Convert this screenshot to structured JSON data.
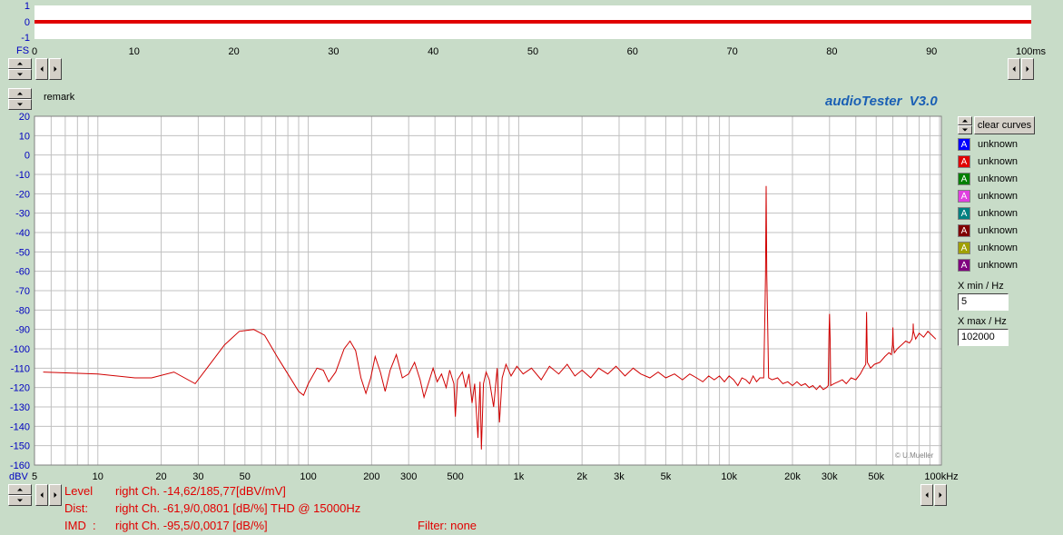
{
  "time_panel": {
    "y_ticks": [
      "1",
      "0",
      "-1"
    ],
    "y_unit": "FS",
    "x_ticks": [
      "0",
      "10",
      "20",
      "30",
      "40",
      "50",
      "60",
      "70",
      "80",
      "90"
    ],
    "x_unit_label": "100ms",
    "signal_color": "#e00000"
  },
  "remark_label": "remark",
  "app_title": "audioTester  V3.0",
  "copyright": "© U.Mueller",
  "clear_curves_label": "clear curves",
  "legend": [
    {
      "label": "unknown",
      "color": "#0000ff"
    },
    {
      "label": "unknown",
      "color": "#e00000"
    },
    {
      "label": "unknown",
      "color": "#008000"
    },
    {
      "label": "unknown",
      "color": "#e040e0"
    },
    {
      "label": "unknown",
      "color": "#008080"
    },
    {
      "label": "unknown",
      "color": "#800000"
    },
    {
      "label": "unknown",
      "color": "#a0a000"
    },
    {
      "label": "unknown",
      "color": "#800080"
    }
  ],
  "legend_glyph": "A",
  "xmin": {
    "label": "X min / Hz",
    "value": "5"
  },
  "xmax": {
    "label": "X max / Hz",
    "value": "102000"
  },
  "status": {
    "level_key": "Level",
    "level_val": "right Ch. -14,62/185,77[dBV/mV]",
    "dist_key": "Dist:",
    "dist_val": "right Ch. -61,9/0,0801 [dB/%] THD @ 15000Hz",
    "imd_key": "IMD  :",
    "imd_val": "right Ch. -95,5/0,0017 [dB/%]",
    "filter": "Filter: none"
  },
  "chart_data": {
    "type": "line",
    "xscale": "log",
    "ylabel": "dBV",
    "xlim": [
      5,
      102000
    ],
    "ylim": [
      -160,
      20
    ],
    "y_ticks": [
      "20",
      "10",
      "0",
      "-10",
      "-20",
      "-30",
      "-40",
      "-50",
      "-60",
      "-70",
      "-80",
      "-90",
      "-100",
      "-110",
      "-120",
      "-130",
      "-140",
      "-150",
      "-160"
    ],
    "x_tick_labels": [
      {
        "v": 5,
        "t": "5"
      },
      {
        "v": 10,
        "t": "10"
      },
      {
        "v": 20,
        "t": "20"
      },
      {
        "v": 30,
        "t": "30"
      },
      {
        "v": 50,
        "t": "50"
      },
      {
        "v": 100,
        "t": "100"
      },
      {
        "v": 200,
        "t": "200"
      },
      {
        "v": 300,
        "t": "300"
      },
      {
        "v": 500,
        "t": "500"
      },
      {
        "v": 1000,
        "t": "1k"
      },
      {
        "v": 2000,
        "t": "2k"
      },
      {
        "v": 3000,
        "t": "3k"
      },
      {
        "v": 5000,
        "t": "5k"
      },
      {
        "v": 10000,
        "t": "10k"
      },
      {
        "v": 20000,
        "t": "20k"
      },
      {
        "v": 30000,
        "t": "30k"
      },
      {
        "v": 50000,
        "t": "50k"
      },
      {
        "v": 102000,
        "t": "100kHz"
      }
    ],
    "grid": true,
    "series": [
      {
        "color": "#d00000",
        "points": [
          [
            5.5,
            -112
          ],
          [
            10,
            -113
          ],
          [
            15,
            -115
          ],
          [
            18,
            -115
          ],
          [
            23,
            -112
          ],
          [
            29,
            -118
          ],
          [
            33,
            -110
          ],
          [
            40,
            -98
          ],
          [
            47,
            -91
          ],
          [
            55,
            -90
          ],
          [
            62,
            -93
          ],
          [
            72,
            -105
          ],
          [
            80,
            -113
          ],
          [
            90,
            -122
          ],
          [
            95,
            -124
          ],
          [
            100,
            -118
          ],
          [
            110,
            -110
          ],
          [
            118,
            -111
          ],
          [
            125,
            -117
          ],
          [
            135,
            -112
          ],
          [
            148,
            -100
          ],
          [
            158,
            -96
          ],
          [
            168,
            -101
          ],
          [
            178,
            -115
          ],
          [
            188,
            -123
          ],
          [
            198,
            -115
          ],
          [
            208,
            -104
          ],
          [
            220,
            -112
          ],
          [
            232,
            -122
          ],
          [
            245,
            -111
          ],
          [
            262,
            -103
          ],
          [
            280,
            -115
          ],
          [
            300,
            -113
          ],
          [
            320,
            -107
          ],
          [
            340,
            -116
          ],
          [
            355,
            -125
          ],
          [
            372,
            -118
          ],
          [
            392,
            -110
          ],
          [
            410,
            -117
          ],
          [
            430,
            -113
          ],
          [
            452,
            -120
          ],
          [
            470,
            -111
          ],
          [
            492,
            -118
          ],
          [
            500,
            -135
          ],
          [
            512,
            -116
          ],
          [
            540,
            -112
          ],
          [
            560,
            -120
          ],
          [
            580,
            -113
          ],
          [
            600,
            -128
          ],
          [
            618,
            -118
          ],
          [
            640,
            -146
          ],
          [
            655,
            -117
          ],
          [
            665,
            -152
          ],
          [
            680,
            -118
          ],
          [
            700,
            -112
          ],
          [
            725,
            -116
          ],
          [
            760,
            -130
          ],
          [
            790,
            -110
          ],
          [
            810,
            -138
          ],
          [
            835,
            -115
          ],
          [
            870,
            -108
          ],
          [
            920,
            -114
          ],
          [
            980,
            -109
          ],
          [
            1050,
            -113
          ],
          [
            1150,
            -110
          ],
          [
            1280,
            -116
          ],
          [
            1400,
            -109
          ],
          [
            1550,
            -113
          ],
          [
            1700,
            -108
          ],
          [
            1850,
            -114
          ],
          [
            2000,
            -111
          ],
          [
            2200,
            -115
          ],
          [
            2400,
            -110
          ],
          [
            2650,
            -113
          ],
          [
            2900,
            -109
          ],
          [
            3200,
            -114
          ],
          [
            3500,
            -110
          ],
          [
            3800,
            -113
          ],
          [
            4200,
            -115
          ],
          [
            4600,
            -112
          ],
          [
            5000,
            -115
          ],
          [
            5500,
            -113
          ],
          [
            6000,
            -116
          ],
          [
            6500,
            -113
          ],
          [
            7000,
            -115
          ],
          [
            7500,
            -117
          ],
          [
            8000,
            -114
          ],
          [
            8500,
            -116
          ],
          [
            9000,
            -114
          ],
          [
            9500,
            -117
          ],
          [
            10000,
            -114
          ],
          [
            10500,
            -116
          ],
          [
            11000,
            -119
          ],
          [
            11500,
            -115
          ],
          [
            12000,
            -116
          ],
          [
            12500,
            -118
          ],
          [
            13000,
            -114
          ],
          [
            13500,
            -117
          ],
          [
            14000,
            -115
          ],
          [
            14600,
            -115
          ],
          [
            14800,
            -80
          ],
          [
            14900,
            -62
          ],
          [
            15000,
            -16
          ],
          [
            15100,
            -62
          ],
          [
            15200,
            -80
          ],
          [
            15400,
            -115
          ],
          [
            16000,
            -116
          ],
          [
            17000,
            -115
          ],
          [
            18000,
            -118
          ],
          [
            19000,
            -117
          ],
          [
            20000,
            -119
          ],
          [
            21000,
            -117
          ],
          [
            22000,
            -119
          ],
          [
            23000,
            -118
          ],
          [
            24000,
            -120
          ],
          [
            25000,
            -119
          ],
          [
            26000,
            -121
          ],
          [
            27000,
            -119
          ],
          [
            28000,
            -121
          ],
          [
            29000,
            -120
          ],
          [
            29600,
            -119
          ],
          [
            29800,
            -95
          ],
          [
            30000,
            -82
          ],
          [
            30200,
            -95
          ],
          [
            30400,
            -119
          ],
          [
            31500,
            -118
          ],
          [
            33000,
            -117
          ],
          [
            34500,
            -116
          ],
          [
            36000,
            -118
          ],
          [
            38000,
            -115
          ],
          [
            40000,
            -116
          ],
          [
            42000,
            -113
          ],
          [
            43500,
            -110
          ],
          [
            44600,
            -108
          ],
          [
            44800,
            -95
          ],
          [
            45000,
            -81
          ],
          [
            45200,
            -95
          ],
          [
            45400,
            -107
          ],
          [
            47000,
            -110
          ],
          [
            49000,
            -108
          ],
          [
            52000,
            -107
          ],
          [
            55000,
            -104
          ],
          [
            57500,
            -102
          ],
          [
            59000,
            -103
          ],
          [
            59700,
            -98
          ],
          [
            60000,
            -89
          ],
          [
            60300,
            -98
          ],
          [
            61000,
            -102
          ],
          [
            63000,
            -100
          ],
          [
            66000,
            -98
          ],
          [
            69000,
            -96
          ],
          [
            72000,
            -97
          ],
          [
            74000,
            -95
          ],
          [
            74800,
            -91
          ],
          [
            75000,
            -87
          ],
          [
            75200,
            -91
          ],
          [
            77000,
            -95
          ],
          [
            80000,
            -92
          ],
          [
            84000,
            -94
          ],
          [
            88000,
            -91
          ],
          [
            92000,
            -93
          ],
          [
            96000,
            -95
          ]
        ]
      }
    ]
  }
}
